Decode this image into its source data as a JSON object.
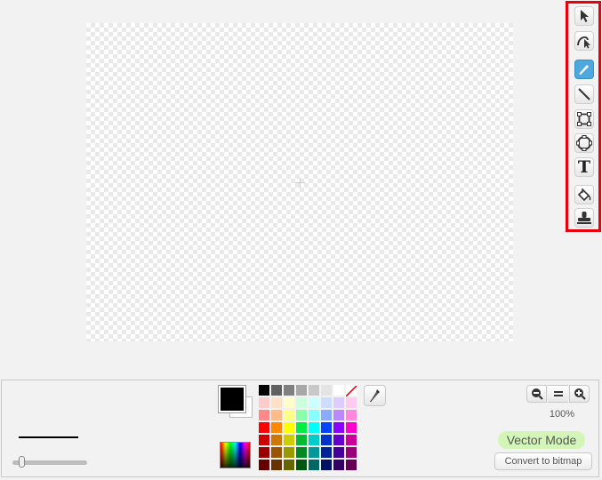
{
  "toolbar": {
    "tools": [
      {
        "id": "select",
        "icon": "arrow-select-icon"
      },
      {
        "id": "reshape",
        "icon": "reshape-icon"
      },
      {
        "id": "pencil",
        "icon": "pencil-icon",
        "selected": true
      },
      {
        "id": "line",
        "icon": "line-icon"
      },
      {
        "id": "rectangle",
        "icon": "rectangle-icon"
      },
      {
        "id": "ellipse",
        "icon": "ellipse-icon"
      },
      {
        "id": "text",
        "icon": "text-icon",
        "glyph": "T"
      },
      {
        "id": "fill",
        "icon": "paint-bucket-icon"
      },
      {
        "id": "stamp",
        "icon": "stamp-icon"
      }
    ],
    "highlight_color": "#e8000b",
    "selected_color": "#4fa8dd"
  },
  "colors": {
    "primary": "#000000",
    "secondary": "#ffffff"
  },
  "palette": [
    [
      "#000000",
      "#606060",
      "#808080",
      "#a8a8a8",
      "#c8c8c8",
      "#e4e4e4",
      "#ffffff",
      "none"
    ],
    [
      "#ffcccc",
      "#ffe0c8",
      "#ffffcc",
      "#ccffdd",
      "#ccffff",
      "#ccddff",
      "#ddccff",
      "#ffccee"
    ],
    [
      "#ff8888",
      "#ffbb88",
      "#ffff88",
      "#88ffaa",
      "#88ffff",
      "#88aaff",
      "#bb88ff",
      "#ff88dd"
    ],
    [
      "#ff0000",
      "#ff8800",
      "#ffff00",
      "#00ee44",
      "#00ffff",
      "#0044ff",
      "#8800ff",
      "#ff00cc"
    ],
    [
      "#cc0000",
      "#cc7700",
      "#cccc00",
      "#00bb33",
      "#00cccc",
      "#0033cc",
      "#6600cc",
      "#cc0099"
    ],
    [
      "#990000",
      "#995500",
      "#999900",
      "#008822",
      "#009999",
      "#002299",
      "#440099",
      "#990077"
    ],
    [
      "#660000",
      "#663300",
      "#666600",
      "#005511",
      "#006666",
      "#001166",
      "#330066",
      "#660055"
    ]
  ],
  "zoom": {
    "level": "100%"
  },
  "mode": {
    "label": "Vector Mode",
    "convert_label": "Convert to bitmap"
  },
  "brush": {
    "size_fraction": 0.12
  }
}
